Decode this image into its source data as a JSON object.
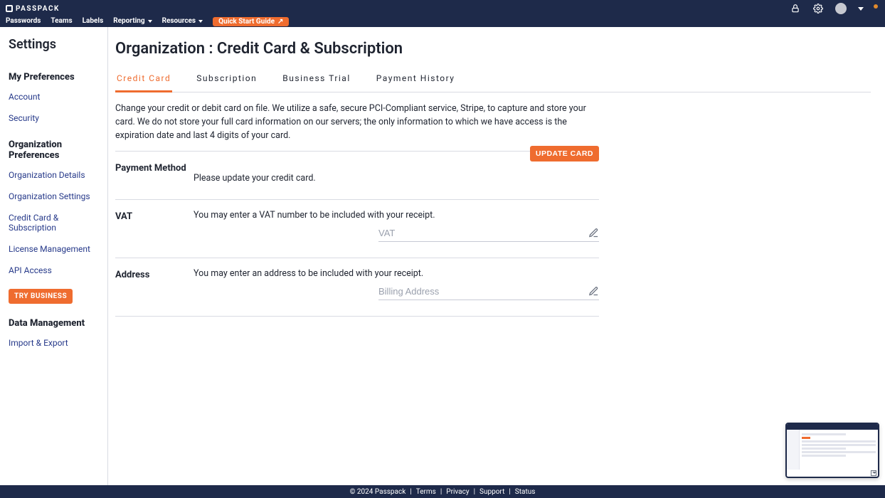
{
  "brand": {
    "name": "PASSPACK"
  },
  "nav": {
    "passwords": "Passwords",
    "teams": "Teams",
    "labels": "Labels",
    "reporting": "Reporting",
    "resources": "Resources",
    "quick_start": "Quick Start Guide"
  },
  "sidebar": {
    "title": "Settings",
    "my_prefs_heading": "My Preferences",
    "my_prefs": {
      "account": "Account",
      "security": "Security"
    },
    "org_prefs_heading": "Organization Preferences",
    "org_prefs": {
      "details": "Organization Details",
      "settings": "Organization Settings",
      "cc_sub": "Credit Card & Subscription",
      "license": "License Management",
      "api": "API Access"
    },
    "try_business": "TRY BUSINESS",
    "data_mgmt_heading": "Data Management",
    "data_mgmt": {
      "import_export": "Import & Export"
    }
  },
  "page": {
    "title": "Organization : Credit Card & Subscription",
    "tabs": {
      "credit_card": "Credit Card",
      "subscription": "Subscription",
      "business_trial": "Business Trial",
      "payment_history": "Payment History"
    },
    "intro": "Change your credit or debit card on file. We utilize a safe, secure PCI-Compliant service, Stripe, to capture and store your card. We do not store your full card information on our servers; the only information to which we have access is the expiration date and last 4 digits of your card.",
    "payment_method": {
      "label": "Payment Method",
      "help": "Please update your credit card.",
      "button": "UPDATE CARD"
    },
    "vat": {
      "label": "VAT",
      "help": "You may enter a VAT number to be included with your receipt.",
      "placeholder": "VAT"
    },
    "address": {
      "label": "Address",
      "help": "You may enter an address to be included with your receipt.",
      "placeholder": "Billing Address"
    }
  },
  "footer": {
    "copyright": "© 2024 Passpack",
    "terms": "Terms",
    "privacy": "Privacy",
    "support": "Support",
    "status": "Status",
    "sep": "|"
  }
}
